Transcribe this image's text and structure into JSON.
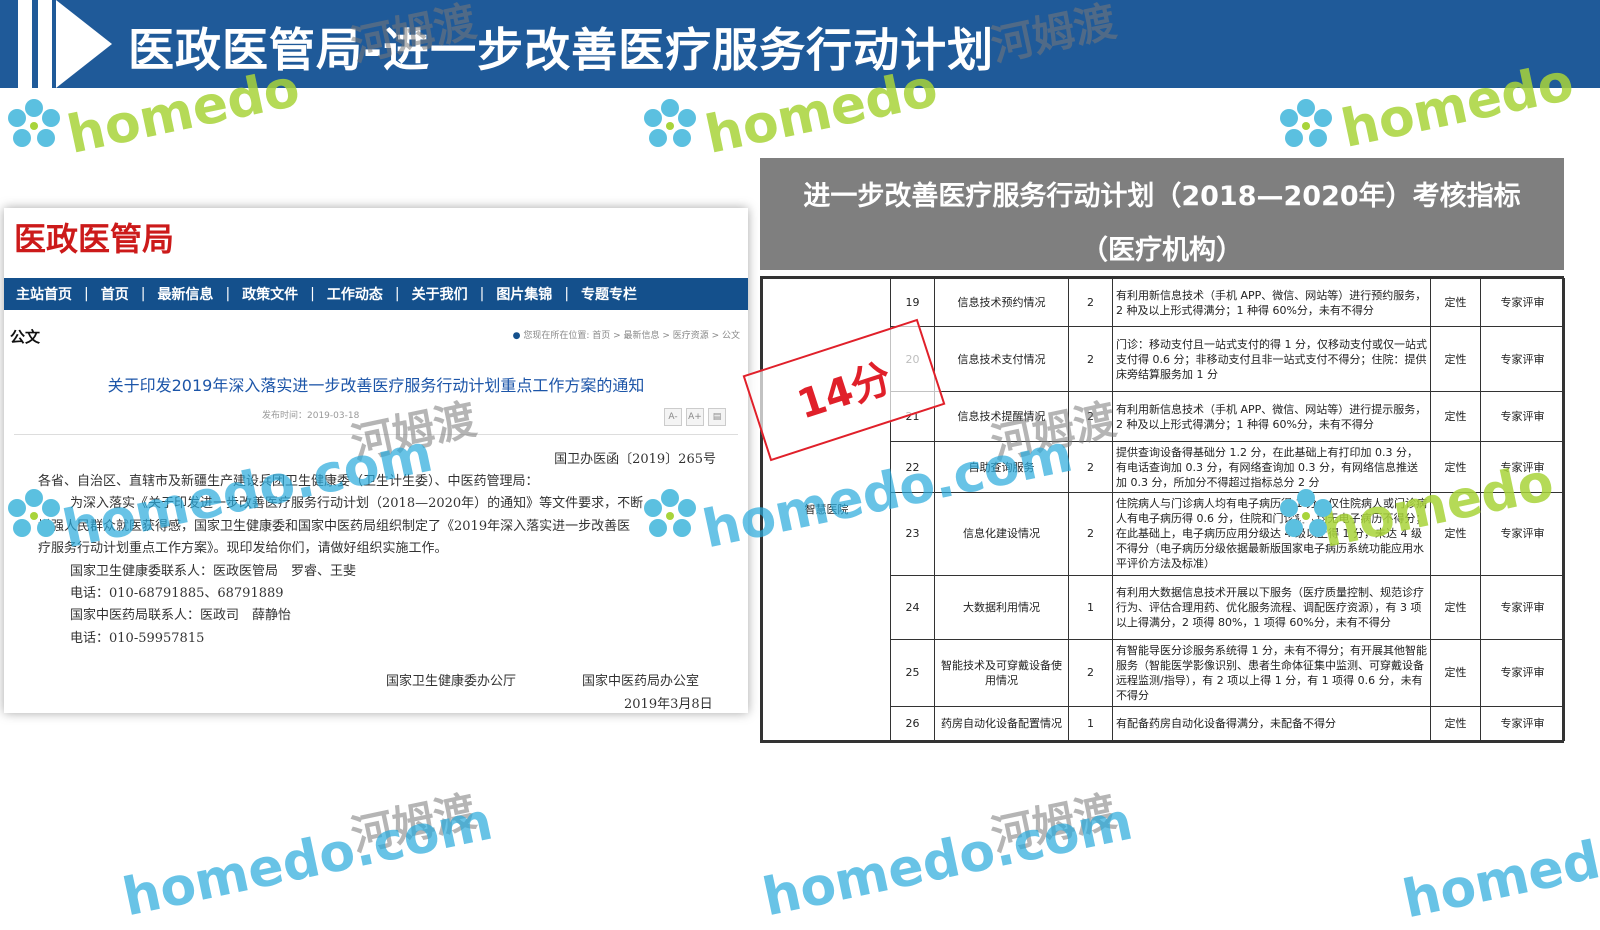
{
  "banner": {
    "title": "医政医管局-进一步改善医疗服务行动计划"
  },
  "watermark": {
    "brand": "homedo",
    "site": "homedo.com",
    "cn": "河姆渡",
    "site_cn": "homedo.com 河姆渡"
  },
  "left": {
    "logo": "医政医管局",
    "nav": [
      "主站首页",
      "首页",
      "最新信息",
      "政策文件",
      "工作动态",
      "关于我们",
      "图片集锦",
      "专题专栏"
    ],
    "nav_sep": "|",
    "section": "公文",
    "breadcrumb": "您现在所在位置: 首页 > 最新信息 > 医疗资源 > 公文",
    "article_title": "关于印发2019年深入落实进一步改善医疗服务行动计划重点工作方案的通知",
    "meta": "发布时间：2019-03-18",
    "tools": [
      "A-",
      "A+",
      "▤"
    ],
    "doc_no": "国卫办医函〔2019〕265号",
    "lines": [
      "各省、自治区、直辖市及新疆生产建设兵团卫生健康委（卫生计生委）、中医药管理局：",
      "为深入落实《关于印发进一步改善医疗服务行动计划（2018—2020年）的通知》等文件要求，不断",
      "增强人民群众就医获得感，国家卫生健康委和国家中医药局组织制定了《2019年深入落实进一步改善医",
      "疗服务行动计划重点工作方案》。现印发给你们，请做好组织实施工作。",
      "国家卫生健康委联系人：医政医管局　罗睿、王斐",
      "电话：010-68791885、68791889",
      "国家中医药局联系人：医政司　薛静怡",
      "电话：010-59957815"
    ],
    "sign1": "国家卫生健康委办公厅",
    "sign2": "国家中医药局办公室",
    "date": "2019年3月8日"
  },
  "right": {
    "header_line1": "进一步改善医疗服务行动计划（2018—2020年）考核指标",
    "header_line2": "（医疗机构）",
    "category": "智慧医院",
    "stamp": "14分",
    "rows": [
      {
        "no": "19",
        "name": "信息技术预约情况",
        "score": "2",
        "desc": "有利用新信息技术（手机 APP、微信、网站等）进行预约服务，2 种及以上形式得满分；1 种得 60%分，未有不得分",
        "type": "定性",
        "method": "专家评审"
      },
      {
        "no": "20",
        "name": "信息技术支付情况",
        "score": "2",
        "desc": "门诊：移动支付且一站式支付的得 1 分，仅移动支付或仅一站式支付得 0.6 分；非移动支付且非一站式支付不得分；住院：提供床旁结算服务加 1 分",
        "type": "定性",
        "method": "专家评审"
      },
      {
        "no": "21",
        "name": "信息技术提醒情况",
        "score": "2",
        "desc": "有利用新信息技术（手机 APP、微信、网站等）进行提示服务，2 种及以上形式得满分；1 种得 60%分，未有不得分",
        "type": "定性",
        "method": "专家评审"
      },
      {
        "no": "22",
        "name": "自助查询服务",
        "score": "2",
        "desc": "提供查询设备得基础分 1.2 分，在此基础上有打印加 0.3 分，有电话查询加 0.3 分，有网络查询加 0.3 分，有网络信息推送加 0.3 分，所加分不得超过指标总分 2 分",
        "type": "定性",
        "method": "专家评审"
      },
      {
        "no": "23",
        "name": "信息化建设情况",
        "score": "2",
        "desc": "住院病人与门诊病人均有电子病历得 1 分，仅住院病人或门诊病人有电子病历得 0.6 分，住院和门诊病人均无电子病历不得分；在此基础上，电子病历应用分级达 4 级以上得 1 分，未达 4 级不得分（电子病历分级依据最新版国家电子病历系统功能应用水平评价方法及标准）",
        "type": "定性",
        "method": "专家评审"
      },
      {
        "no": "24",
        "name": "大数据利用情况",
        "score": "1",
        "desc": "有利用大数据信息技术开展以下服务（医疗质量控制、规范诊疗行为、评估合理用药、优化服务流程、调配医疗资源），有 3 项以上得满分，2 项得 80%，1 项得 60%分，未有不得分",
        "type": "定性",
        "method": "专家评审"
      },
      {
        "no": "25",
        "name": "智能技术及可穿戴设备使用情况",
        "score": "2",
        "desc": "有智能导医分诊服务系统得 1 分，未有不得分；有开展其他智能服务（智能医学影像识别、患者生命体征集中监测、可穿戴设备远程监测/指导），有 2 项以上得 1 分，有 1 项得 0.6 分，未有不得分",
        "type": "定性",
        "method": "专家评审"
      },
      {
        "no": "26",
        "name": "药房自动化设备配置情况",
        "score": "1",
        "desc": "有配备药房自动化设备得满分，未配备不得分",
        "type": "定性",
        "method": "专家评审"
      }
    ]
  },
  "colors": {
    "banner": "#1f5a99",
    "nav": "#14508c",
    "logo_red": "#cc1a1a",
    "stamp_red": "#e0202a",
    "header_gray": "#7f7f7f"
  }
}
